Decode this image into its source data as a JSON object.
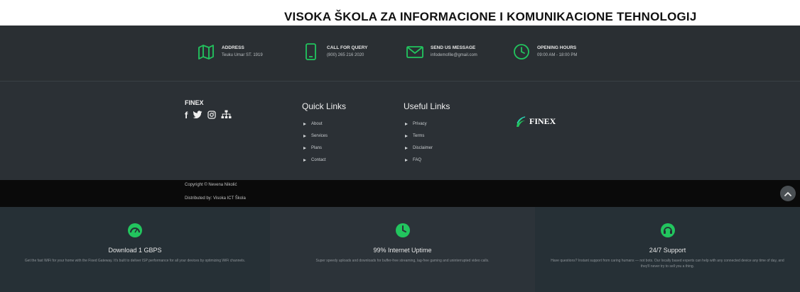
{
  "document": {
    "title": "VISOKA ŠKOLA ZA INFORMACIONE I KOMUNIKACIONE TEHNOLOGIJ"
  },
  "contact_bar": {
    "items": [
      {
        "icon": "map-icon",
        "title": "ADDRESS",
        "value": "Teuku Umar ST. 1919"
      },
      {
        "icon": "phone-icon",
        "title": "CALL FOR QUERY",
        "value": "(800) 265 216 2020"
      },
      {
        "icon": "envelope-icon",
        "title": "SEND US MESSAGE",
        "value": "infodemofile@gmail.com"
      },
      {
        "icon": "clock-icon",
        "title": "OPENING HOURS",
        "value": "09:00 AM - 18:00 PM"
      }
    ],
    "accent": "#22c55e"
  },
  "footer": {
    "brand": "FINEX",
    "social_icons": [
      "facebook-icon",
      "twitter-icon",
      "instagram-icon",
      "sitemap-icon"
    ],
    "quick_links": {
      "heading": "Quick Links",
      "items": [
        "About",
        "Services",
        "Plans",
        "Contact"
      ]
    },
    "useful_links": {
      "heading": "Useful Links",
      "items": [
        "Privacy",
        "Terms",
        "Disclaimer",
        "FAQ"
      ]
    },
    "logo_text": "FINEX"
  },
  "copyright": {
    "line1": "Copyright © Nevena Nikolić",
    "line2": "Distributed by: Visoka ICT Škola"
  },
  "features": [
    {
      "icon": "speedometer-icon",
      "title": "Download 1 GBPS",
      "desc": "Get the fast WiFi for your home with the Fixed Gateway. It's built to deliver ISP performance for all your devices by optimizing WiFi channels."
    },
    {
      "icon": "clock-icon",
      "title": "99% Internet Uptime",
      "desc": "Super speedy uploads and downloads for buffer-free streaming, lag-free gaming and uninterrupted video calls."
    },
    {
      "icon": "headset-icon",
      "title": "24/7 Support",
      "desc": "Have questions? Instant support from caring humans — not bots. Our locally based experts can help with any connected device any time of day, and they'll never try to sell you a thing."
    }
  ]
}
